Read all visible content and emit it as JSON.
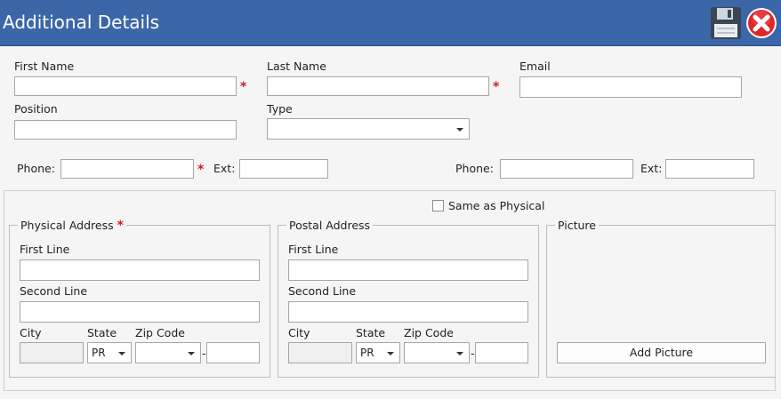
{
  "window": {
    "title": "Additional Details"
  },
  "toolbar": {
    "save_icon": "floppy-disk-icon",
    "close_icon": "red-x-close-icon"
  },
  "contact": {
    "first_name_label": "First Name",
    "last_name_label": "Last Name",
    "email_label": "Email",
    "position_label": "Position",
    "type_label": "Type",
    "phone_label": "Phone:",
    "ext_label": "Ext:",
    "phone2_label": "Phone:",
    "ext2_label": "Ext:",
    "required_marker": "*"
  },
  "address": {
    "same_as_physical_label": "Same as Physical",
    "physical_title": "Physical Address",
    "postal_title": "Postal Address",
    "picture_title": "Picture",
    "first_line_label": "First Line",
    "second_line_label": "Second Line",
    "city_label": "City",
    "state_label": "State",
    "zip_label": "Zip Code",
    "physical_state_value": "PR",
    "postal_state_value": "PR",
    "zip_separator": "-",
    "add_picture_label": "Add Picture"
  },
  "colors": {
    "title_bar": "#3b66a8",
    "required": "#d21a1a",
    "close_button": "#e0262b"
  }
}
